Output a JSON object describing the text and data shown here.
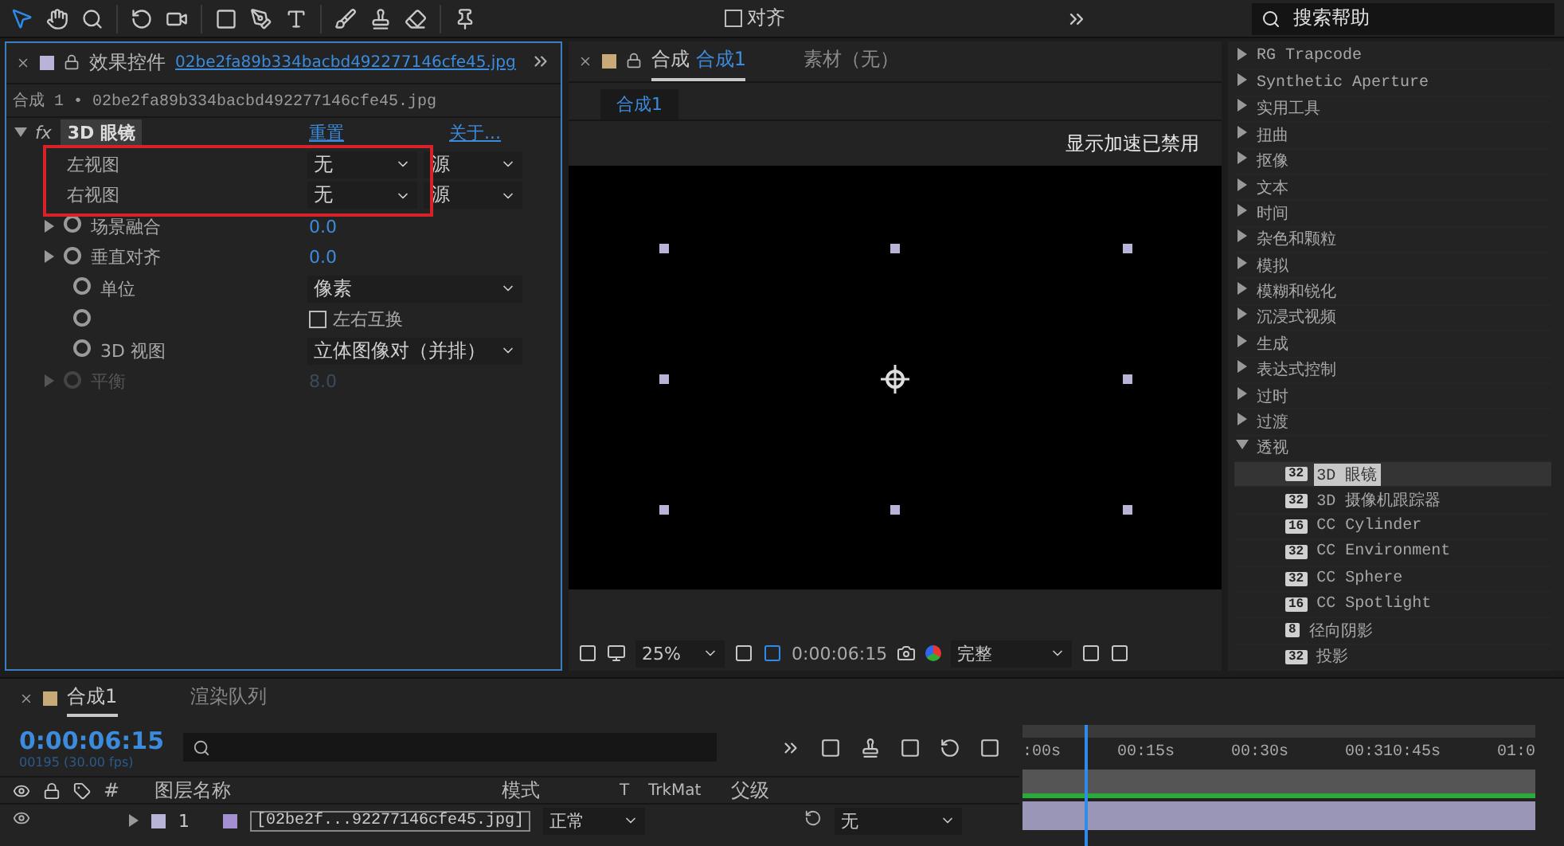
{
  "toolbar": {
    "align_label": "对齐",
    "align_checked": false,
    "search_placeholder": "搜索帮助"
  },
  "effect_panel": {
    "tab_label": "效果控件",
    "tab_file": "02be2fa89b334bacbd492277146cfe45.jpg",
    "breadcrumb": "合成 1 • 02be2fa89b334bacbd492277146cfe45.jpg",
    "effect": {
      "fx_label": "fx",
      "name": "3D 眼镜",
      "expanded": true,
      "reset": "重置",
      "about": "关于..."
    },
    "properties": [
      {
        "kind": "dual",
        "label": "左视图",
        "value": "无",
        "value2": "源",
        "highlighted": true
      },
      {
        "kind": "dual",
        "label": "右视图",
        "value": "无",
        "value2": "源",
        "highlighted": true
      },
      {
        "kind": "number",
        "label": "场景融合",
        "value": "0.0",
        "disabled": false
      },
      {
        "kind": "number",
        "label": "垂直对齐",
        "value": "0.0",
        "disabled": false
      },
      {
        "kind": "dropdown",
        "label": "单位",
        "value": "像素"
      },
      {
        "kind": "checkbox",
        "value": "左右互换",
        "checked": false
      },
      {
        "kind": "dropdown",
        "label": "3D 视图",
        "value": "立体图像对（并排）"
      },
      {
        "kind": "number",
        "label": "平衡",
        "value": "8.0",
        "disabled": true
      }
    ]
  },
  "comp_panel": {
    "tabs": [
      {
        "label": "合成",
        "name": "合成1",
        "selected": true
      },
      {
        "label": "素材（无）",
        "selected": false
      }
    ],
    "chip": "合成1",
    "notice": "显示加速已禁用",
    "zoom": "25%",
    "timecode": "0:00:06:15",
    "resolution": "完整"
  },
  "effects_list": [
    {
      "label": "RG Trapcode",
      "expanded": false
    },
    {
      "label": "Synthetic Aperture",
      "expanded": false
    },
    {
      "label": "实用工具",
      "expanded": false
    },
    {
      "label": "扭曲",
      "expanded": false
    },
    {
      "label": "抠像",
      "expanded": false
    },
    {
      "label": "文本",
      "expanded": false
    },
    {
      "label": "时间",
      "expanded": false
    },
    {
      "label": "杂色和颗粒",
      "expanded": false
    },
    {
      "label": "模拟",
      "expanded": false
    },
    {
      "label": "模糊和锐化",
      "expanded": false
    },
    {
      "label": "沉浸式视频",
      "expanded": false
    },
    {
      "label": "生成",
      "expanded": false
    },
    {
      "label": "表达式控制",
      "expanded": false
    },
    {
      "label": "过时",
      "expanded": false
    },
    {
      "label": "过渡",
      "expanded": false
    },
    {
      "label": "透视",
      "expanded": true,
      "children": [
        {
          "label": "3D 眼镜",
          "badge": "32",
          "selected": true
        },
        {
          "label": "3D 摄像机跟踪器",
          "badge": "32",
          "selected": false
        },
        {
          "label": "CC Cylinder",
          "badge": "16",
          "selected": false
        },
        {
          "label": "CC Environment",
          "badge": "32",
          "selected": false
        },
        {
          "label": "CC Sphere",
          "badge": "32",
          "selected": false
        },
        {
          "label": "CC Spotlight",
          "badge": "16",
          "selected": false
        },
        {
          "label": "径向阴影",
          "badge": "8",
          "selected": false
        },
        {
          "label": "投影",
          "badge": "32",
          "selected": false
        }
      ]
    }
  ],
  "timeline": {
    "tabs": [
      {
        "label": "合成1",
        "selected": true
      },
      {
        "label": "渲染队列",
        "selected": false
      }
    ],
    "timecode": "0:00:06:15",
    "fps": "00195 (30.00 fps)",
    "columns": [
      "#",
      "图层名称",
      "模式",
      "T",
      "TrkMat",
      "父级"
    ],
    "ruler": [
      ":00s",
      "00:15s",
      "00:30s",
      "00:310:45s",
      "01:0"
    ],
    "playhead": {
      "level": 0.12
    },
    "layers": [
      {
        "number": "1",
        "name": "[02be2f...92277146cfe45.jpg]",
        "mode": "正常",
        "parent": "无",
        "visible": true
      }
    ]
  }
}
